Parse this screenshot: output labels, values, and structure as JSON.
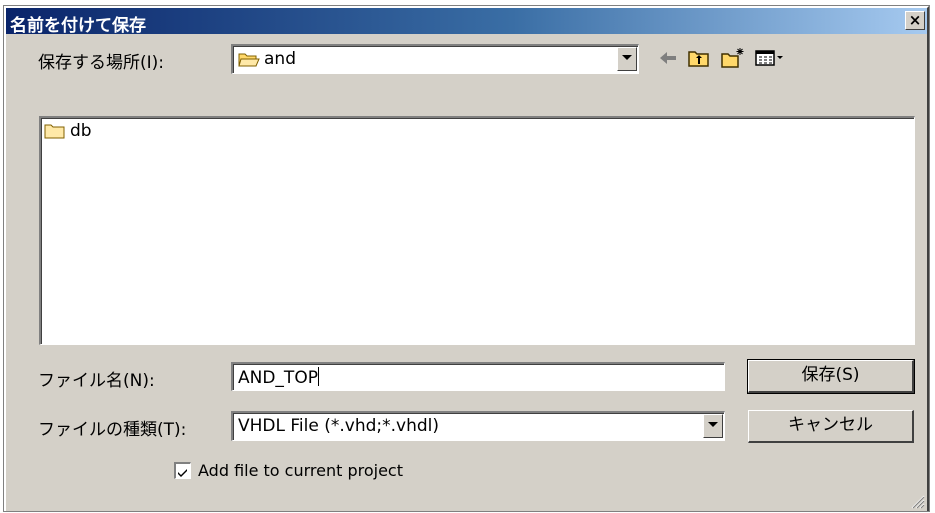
{
  "window": {
    "title": "名前を付けて保存",
    "close_glyph": "×"
  },
  "location": {
    "label": "保存する場所(I):",
    "value": "and",
    "icon": "open-folder-icon"
  },
  "toolbar": {
    "icons": [
      "back-arrow-icon",
      "up-folder-icon",
      "new-folder-icon",
      "view-menu-icon"
    ]
  },
  "file_list": {
    "items": [
      {
        "name": "db",
        "icon": "folder-icon"
      }
    ]
  },
  "filename": {
    "label": "ファイル名(N):",
    "value": "AND_TOP"
  },
  "filetype": {
    "label": "ファイルの種類(T):",
    "value": "VHDL File (*.vhd;*.vhdl)"
  },
  "buttons": {
    "save_label": "保存(S)",
    "cancel_label": "キャンセル"
  },
  "options": {
    "add_to_project_label": "Add file to current project",
    "add_to_project_checked": true
  },
  "colors": {
    "dialog_bg": "#d4d0c8",
    "title_start": "#0a246a",
    "title_end": "#a6caf0"
  }
}
